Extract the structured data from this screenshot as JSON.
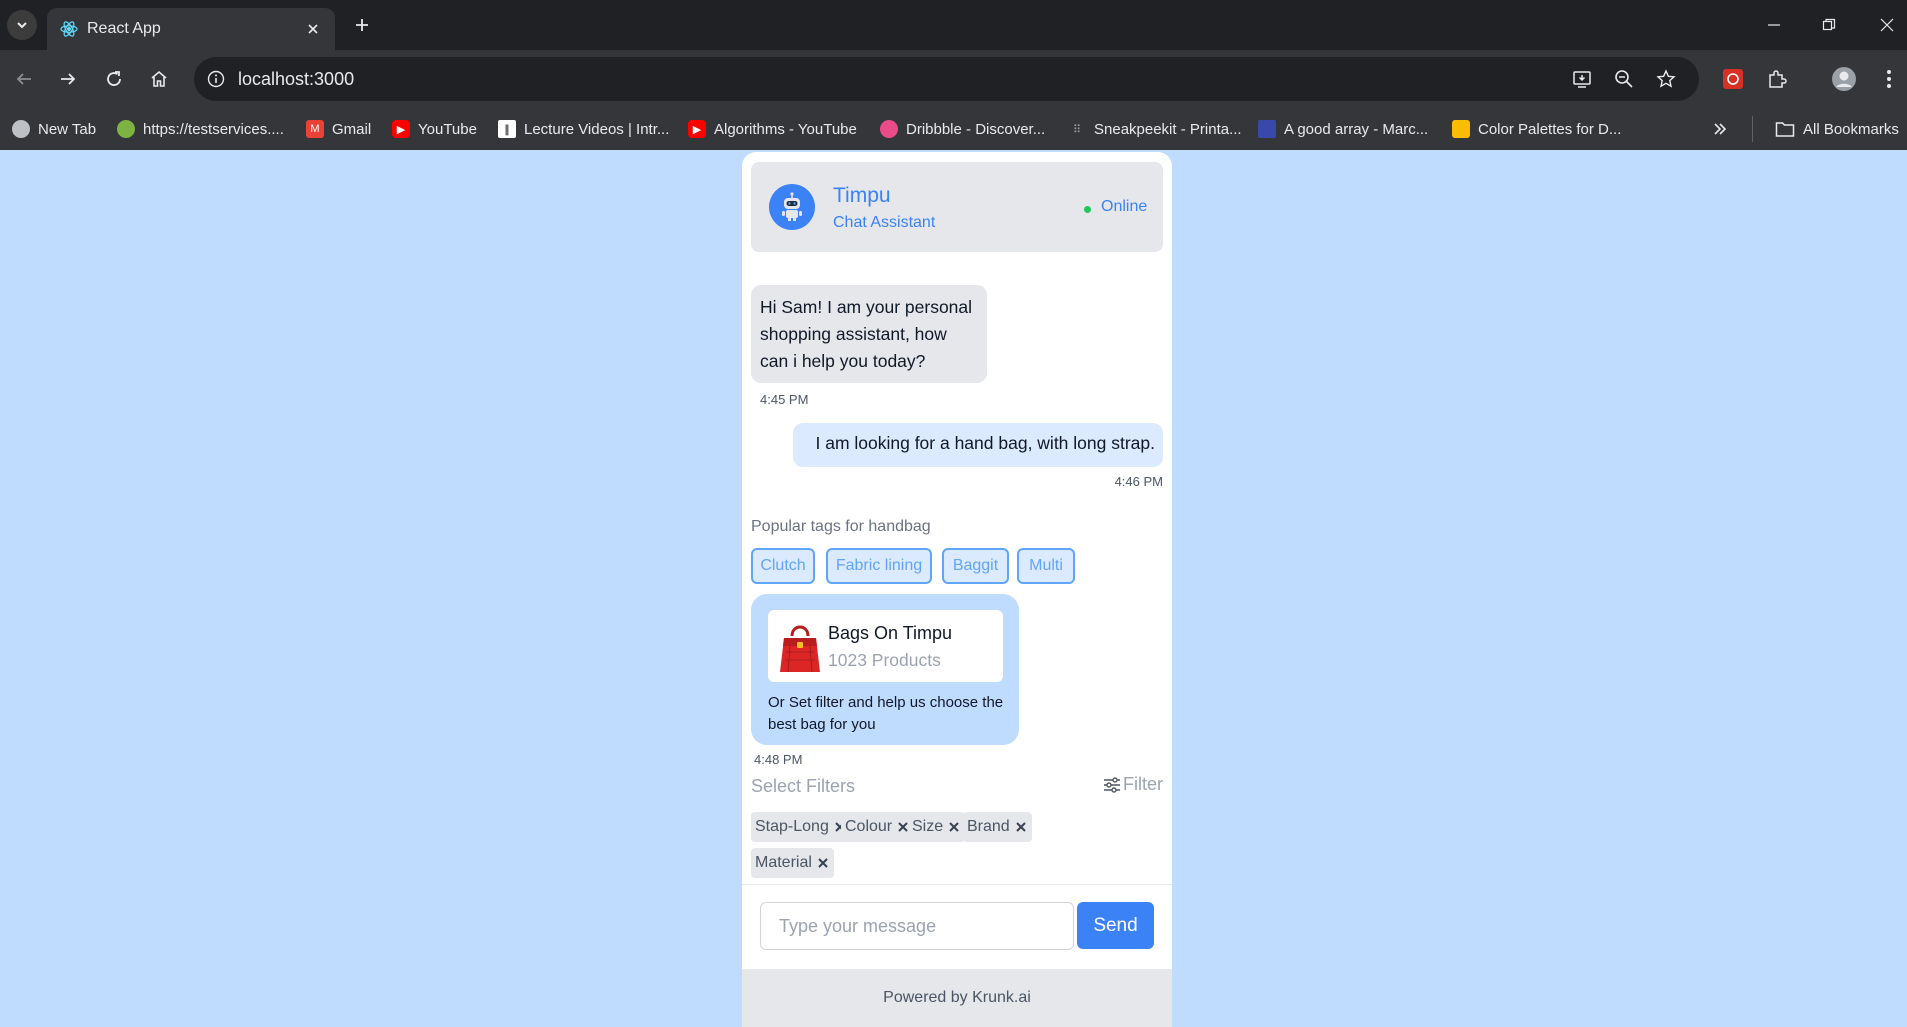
{
  "browser": {
    "tab_title": "React App",
    "url": "localhost:3000",
    "bookmarks": [
      {
        "label": "New Tab",
        "icon": "globe-icon"
      },
      {
        "label": "https://testservices....",
        "icon": "site-icon"
      },
      {
        "label": "Gmail",
        "icon": "gmail-icon"
      },
      {
        "label": "YouTube",
        "icon": "youtube-icon"
      },
      {
        "label": "Lecture Videos | Intr...",
        "icon": "mit-icon"
      },
      {
        "label": "Algorithms - YouTube",
        "icon": "youtube-icon"
      },
      {
        "label": "Dribbble - Discover...",
        "icon": "dribbble-icon"
      },
      {
        "label": "Sneakpeekit - Printa...",
        "icon": "grid-icon"
      },
      {
        "label": "A good array - Marc...",
        "icon": "doc-icon"
      },
      {
        "label": "Color Palettes for D...",
        "icon": "palette-icon"
      }
    ],
    "all_bookmarks": "All Bookmarks"
  },
  "chat": {
    "header": {
      "name": "Timpu",
      "role": "Chat Assistant",
      "status": "Online"
    },
    "messages": [
      {
        "from": "bot",
        "text": "Hi Sam! I am your personal shopping assistant, how can i help you today?",
        "time": "4:45 PM"
      },
      {
        "from": "user",
        "text": "I am looking for a hand bag, with long strap.",
        "time": "4:46 PM"
      }
    ],
    "tags_label": "Popular tags for handbag",
    "tags": [
      "Clutch",
      "Fabric lining",
      "Baggit",
      "Multi"
    ],
    "product": {
      "title": "Bags On Timpu",
      "count": "1023 Products",
      "subtitle": "Or Set filter and help us choose the best bag for you",
      "time": "4:48 PM"
    },
    "filters_label": "Select Filters",
    "filter_button": "Filter",
    "filters": [
      "Stap-Long",
      "Colour",
      "Size",
      "Brand",
      "Material"
    ],
    "input_placeholder": "Type your message",
    "send_label": "Send",
    "footer": "Powered by Krunk.ai"
  },
  "colors": {
    "accent": "#3b82f6",
    "page_bg": "#bfdbfe",
    "online": "#22c55e"
  }
}
